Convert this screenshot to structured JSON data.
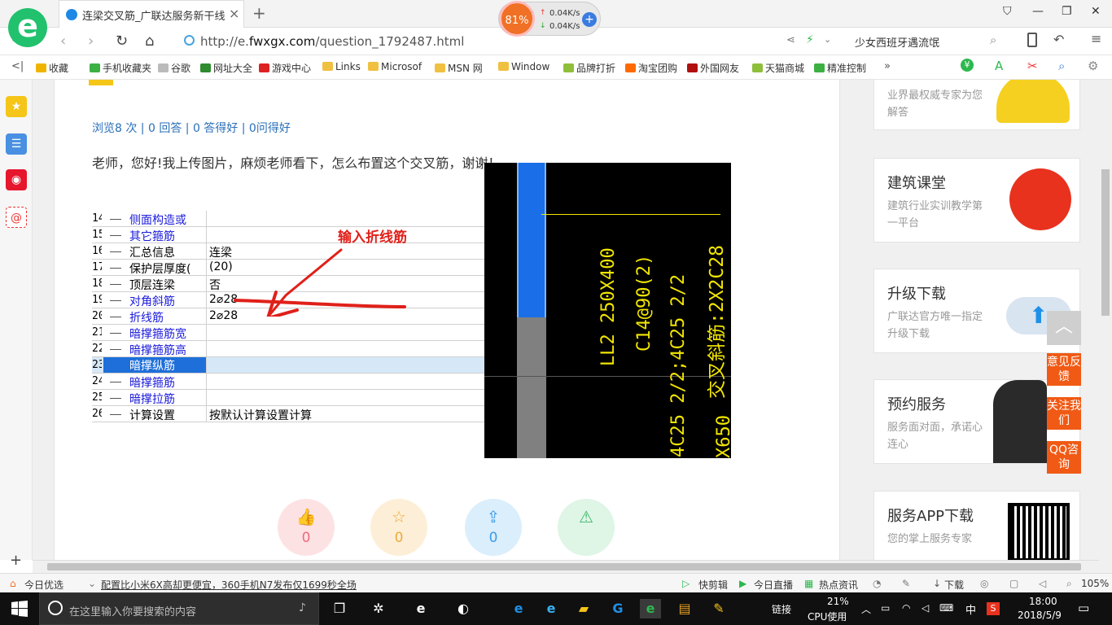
{
  "tab": {
    "title": "连梁交叉筋_广联达服务新干线",
    "close": "×",
    "new_tab": "+"
  },
  "speed_widget": {
    "cpu": "81%",
    "up": "0.04K/s",
    "down": "0.04K/s"
  },
  "address": {
    "url_prefix": "http://e.",
    "url_domain": "fwxgx.com",
    "url_path": "/question_1792487.html",
    "search_hint": "少女西班牙遇流氓"
  },
  "bookmarks": [
    {
      "label": "收藏",
      "color": "#f0b400"
    },
    {
      "label": "手机收藏夹",
      "color": "#3cb043"
    },
    {
      "label": "谷歌",
      "color": "#bbbbbb"
    },
    {
      "label": "网址大全",
      "color": "#2e8b2e"
    },
    {
      "label": "游戏中心",
      "color": "#d22"
    },
    {
      "label": "Links",
      "color": "#f0c040"
    },
    {
      "label": "Microsof",
      "color": "#f0c040"
    },
    {
      "label": "MSN 网",
      "color": "#f0c040"
    },
    {
      "label": "Window",
      "color": "#f0c040"
    },
    {
      "label": "品牌打折",
      "color": "#8fbf3a"
    },
    {
      "label": "淘宝团购",
      "color": "#ff6a00"
    },
    {
      "label": "外国网友",
      "color": "#b01010"
    },
    {
      "label": "天猫商城",
      "color": "#8fbf3a"
    },
    {
      "label": "精准控制",
      "color": "#3cb043"
    }
  ],
  "main": {
    "stats": "浏览8 次 | 0 回答 | 0 答得好 | 0问得好",
    "question": "老师，您好!我上传图片，麻烦老师看下，怎么布置这个交叉筋，谢谢！",
    "annotation": "输入折线筋"
  },
  "sheet_rows": [
    {
      "num": "14",
      "label": "侧面构造或",
      "value": "",
      "color": "#1a1adc"
    },
    {
      "num": "15",
      "label": "其它箍筋",
      "value": "",
      "color": "#1a1adc"
    },
    {
      "num": "16",
      "label": "汇总信息",
      "value": "连梁",
      "color": "#000"
    },
    {
      "num": "17",
      "label": "保护层厚度(",
      "value": "(20)",
      "color": "#000"
    },
    {
      "num": "18",
      "label": "顶层连梁",
      "value": "否",
      "color": "#000"
    },
    {
      "num": "19",
      "label": "对角斜筋",
      "value": "2⌀28",
      "color": "#1a1adc"
    },
    {
      "num": "20",
      "label": "折线筋",
      "value": "2⌀28",
      "color": "#1a1adc"
    },
    {
      "num": "21",
      "label": "暗撑箍筋宽",
      "value": "",
      "color": "#1a1adc"
    },
    {
      "num": "22",
      "label": "暗撑箍筋高",
      "value": "",
      "color": "#1a1adc"
    },
    {
      "num": "23",
      "label": "暗撑纵筋",
      "value": "",
      "color": "#1a1adc"
    },
    {
      "num": "24",
      "label": "暗撑箍筋",
      "value": "",
      "color": "#1a1adc"
    },
    {
      "num": "25",
      "label": "暗撑拉筋",
      "value": "",
      "color": "#1a1adc"
    },
    {
      "num": "26",
      "label": "计算设置",
      "value": "按默认计算设置计算",
      "color": "#000"
    }
  ],
  "cad": {
    "line1": "LL2  250X400",
    "line2": "C14@90(2)",
    "line3": "4C25  2/2;4C25  2/2",
    "line4": "交叉斜筋:2X2C28",
    "line5": "X650"
  },
  "actions": [
    {
      "name": "like",
      "icon": "👍",
      "count": "0",
      "bg": "#fde2e4",
      "fg": "#f06a7a"
    },
    {
      "name": "favorite",
      "icon": "☆",
      "count": "0",
      "bg": "#fdefd7",
      "fg": "#f0a83a"
    },
    {
      "name": "share",
      "icon": "⇪",
      "count": "0",
      "bg": "#dbeefc",
      "fg": "#3a9be8"
    },
    {
      "name": "report",
      "icon": "⚠",
      "count": "",
      "bg": "#dff5e6",
      "fg": "#3cb86a"
    }
  ],
  "cards": [
    {
      "title": "",
      "sub": "业界最权威专家为您解答"
    },
    {
      "title": "建筑课堂",
      "sub": "建筑行业实训教学第一平台"
    },
    {
      "title": "升级下载",
      "sub": "广联达官方唯一指定升级下载"
    },
    {
      "title": "预约服务",
      "sub": "服务面对面，承诺心连心"
    },
    {
      "title": "服务APP下载",
      "sub": "您的掌上服务专家"
    }
  ],
  "float_buttons": [
    "意见反馈",
    "关注我们",
    "QQ咨询"
  ],
  "statusbar": {
    "today": "今日优选",
    "news": "配置比小米6X高却更便宜，360手机N7发布仅1699秒全场",
    "clip": "快剪辑",
    "live": "今日直播",
    "hot": "热点资讯",
    "download": "下载",
    "zoom": "105%"
  },
  "taskbar": {
    "search_placeholder": "在这里输入你要搜索的内容",
    "link": "链接",
    "cpu_pct": "21%",
    "cpu_label": "CPU使用",
    "ime": "中",
    "time": "18:00",
    "date": "2018/5/9"
  }
}
